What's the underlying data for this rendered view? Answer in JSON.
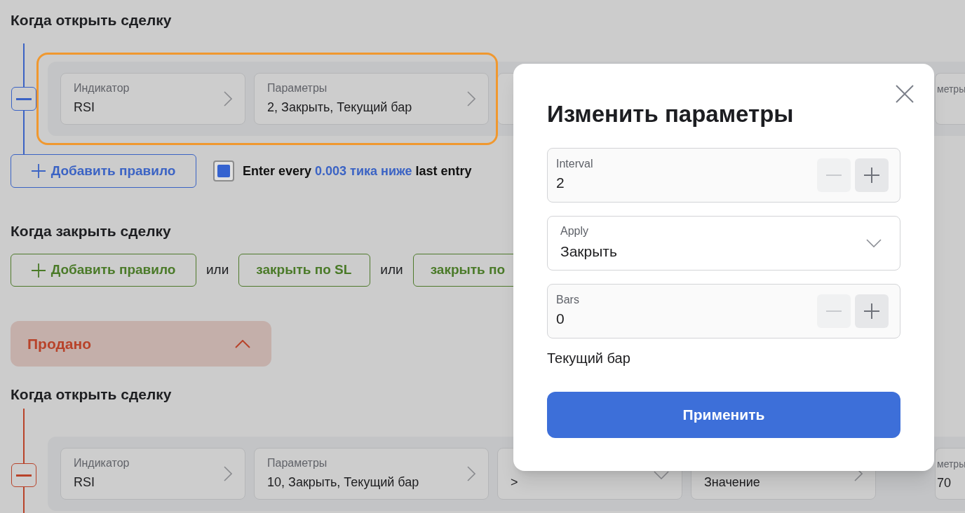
{
  "open_long": {
    "title": "Когда открыть сделку",
    "rule": {
      "kind": "buy",
      "highlighted": true,
      "cards": [
        {
          "kind": "link",
          "label": "Индикатор",
          "value": "RSI"
        },
        {
          "kind": "link",
          "label": "Параметры",
          "value": "2, Закрыть, Текущий бар"
        },
        {
          "kind": "blank"
        },
        {
          "kind": "link",
          "label": "метры"
        }
      ]
    },
    "add_rule": "Добавить правило",
    "repeat": {
      "checked": true,
      "prefix": "Enter every",
      "link": "0.003 тика ниже",
      "suffix": "last entry"
    }
  },
  "close_long": {
    "title": "Когда закрыть сделку",
    "items": [
      {
        "kind": "add",
        "text": "Добавить правило"
      },
      {
        "kind": "separator",
        "text": "или"
      },
      {
        "kind": "option",
        "text": "закрыть по SL"
      },
      {
        "kind": "separator",
        "text": "или"
      },
      {
        "kind": "option",
        "text": "закрыть по"
      }
    ]
  },
  "sold_panel": {
    "title": "Продано",
    "expanded": true
  },
  "open_short": {
    "title": "Когда открыть сделку",
    "rule": {
      "kind": "sell",
      "highlighted": false,
      "cards": [
        {
          "kind": "link",
          "label": "Индикатор",
          "value": "RSI"
        },
        {
          "kind": "link",
          "label": "Параметры",
          "value": "10, Закрыть, Текущий бар"
        },
        {
          "kind": "select",
          "value": ">"
        },
        {
          "kind": "link",
          "value": "Значение"
        },
        {
          "kind": "link",
          "label": "метры",
          "value": "70"
        }
      ]
    }
  },
  "dialog": {
    "title": "Изменить параметры",
    "fields": [
      {
        "kind": "stepper",
        "label": "Interval",
        "value": "2",
        "decrement_disabled": true
      },
      {
        "kind": "select",
        "label": "Apply",
        "value": "Закрыть"
      },
      {
        "kind": "stepper",
        "label": "Bars",
        "value": "0",
        "decrement_disabled": true
      },
      {
        "kind": "note",
        "text": "Текущий бар"
      }
    ],
    "submit": "Применить"
  }
}
